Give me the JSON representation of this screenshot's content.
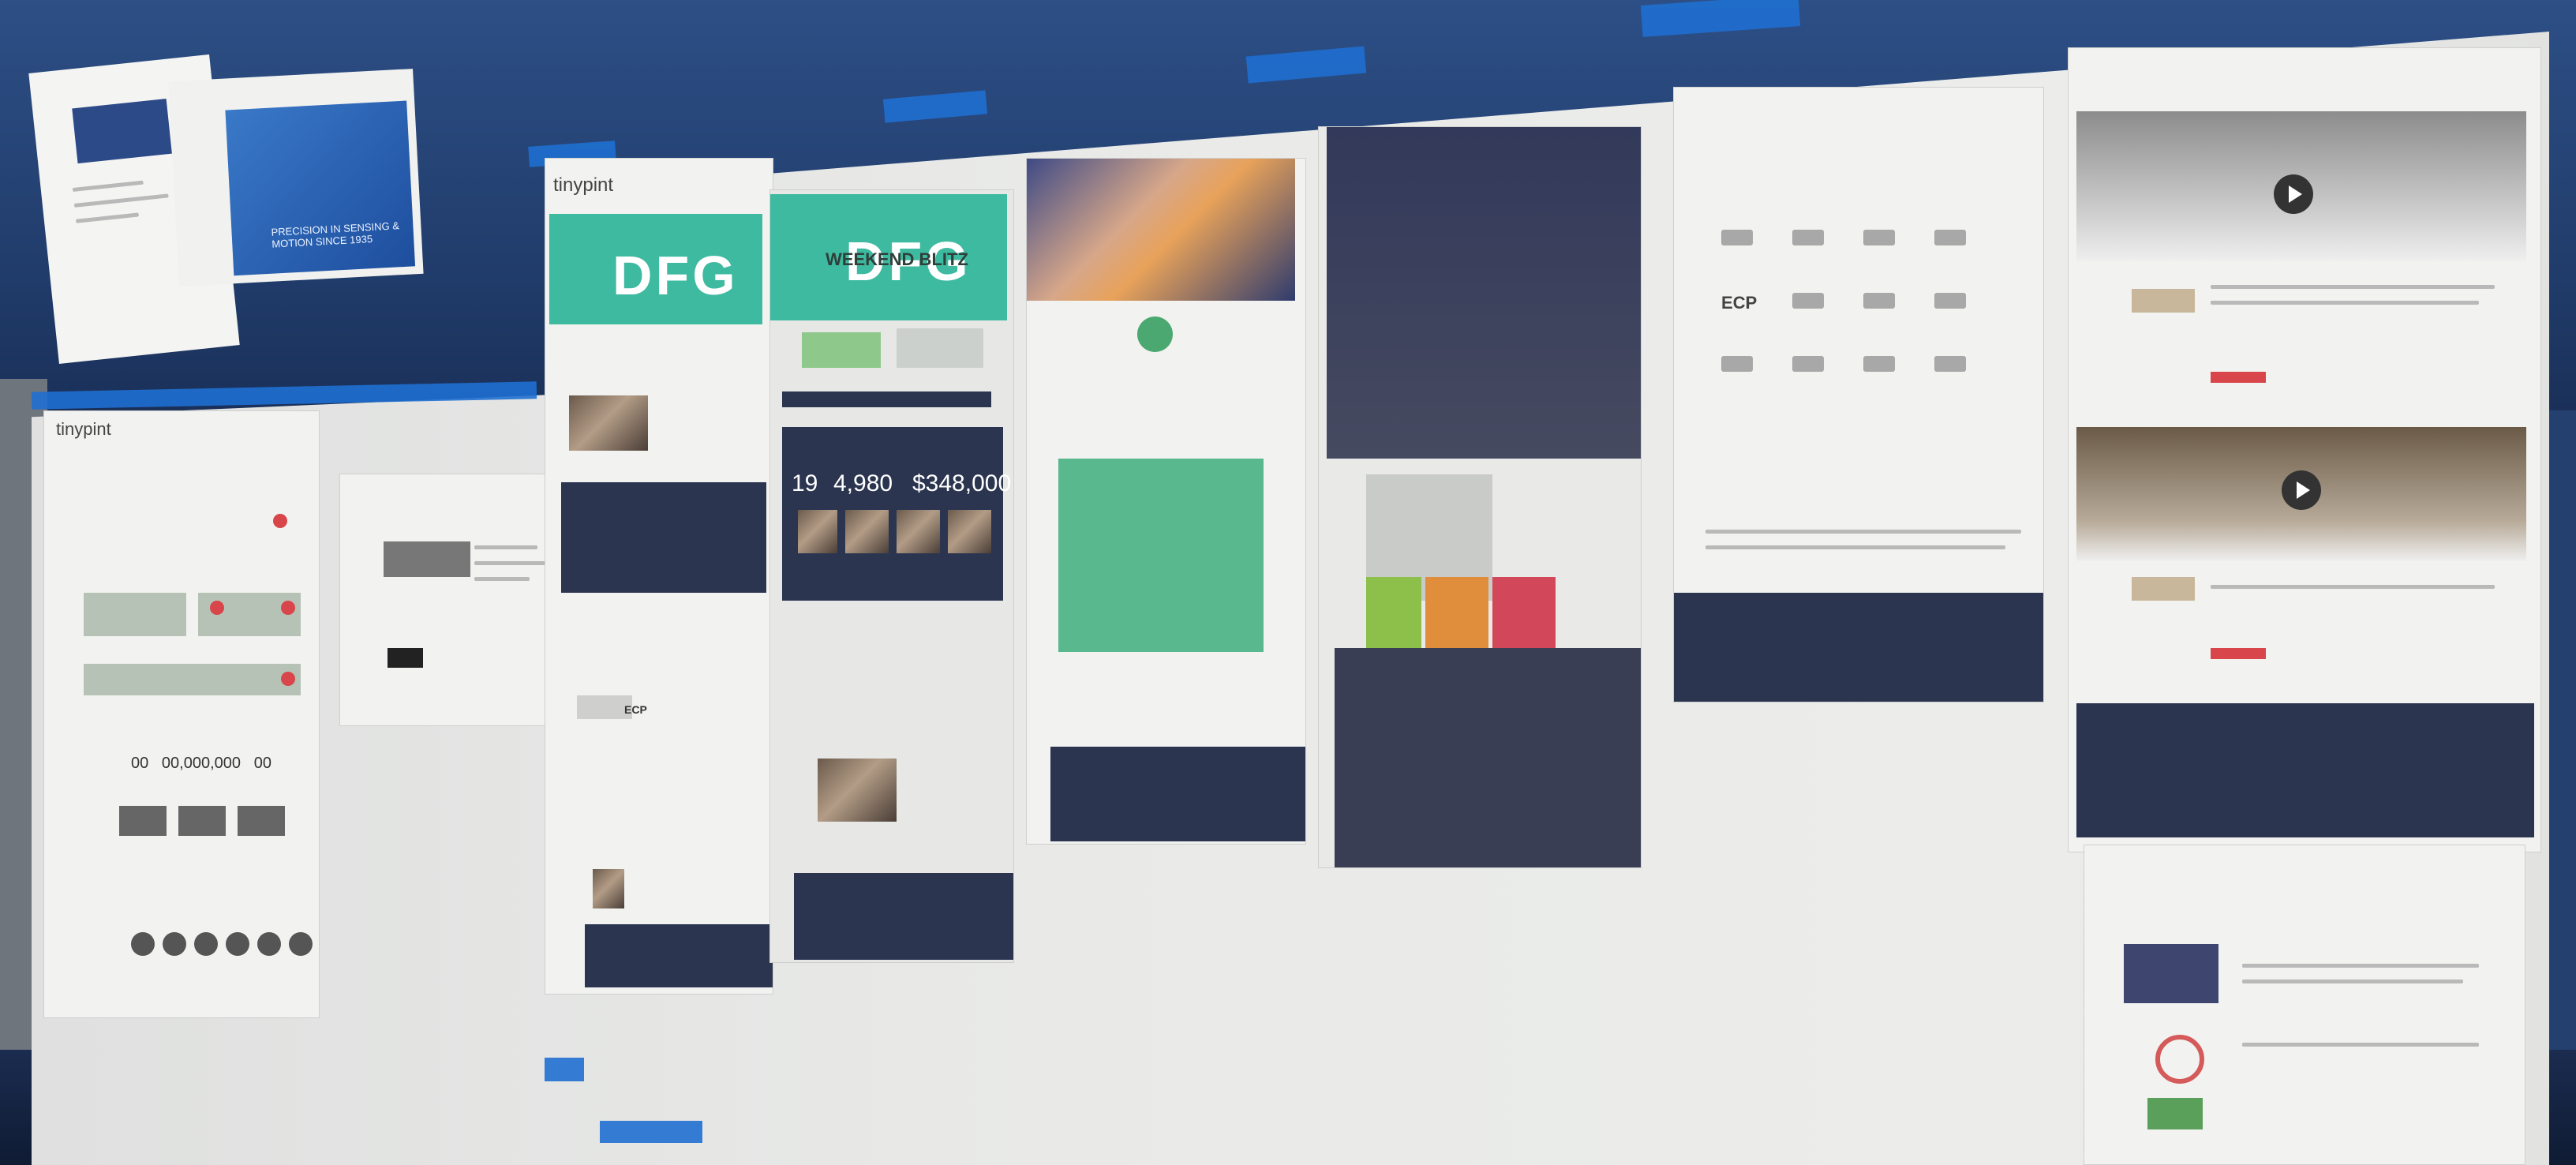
{
  "brand": {
    "name": "tinypint"
  },
  "hero": {
    "title": "DFG",
    "subtitle": "WEEKEND BLITZ"
  },
  "stats": [
    "19",
    "4,980",
    "$348,000"
  ],
  "wireframe": {
    "placeholder_numbers": [
      "00",
      "00,000,000",
      "00"
    ]
  },
  "brochure": {
    "text": "PRECISION IN SENSING & MOTION SINCE 1935"
  },
  "logos": [
    "ECP"
  ],
  "colors": {
    "wall": "#24406f",
    "paper": "#ebecea",
    "tape": "#1f6fd0",
    "navy_footer": "#2b3550",
    "teal": "#3dbaa0",
    "accent_red": "#d8454a",
    "green": "#5ab88f"
  }
}
